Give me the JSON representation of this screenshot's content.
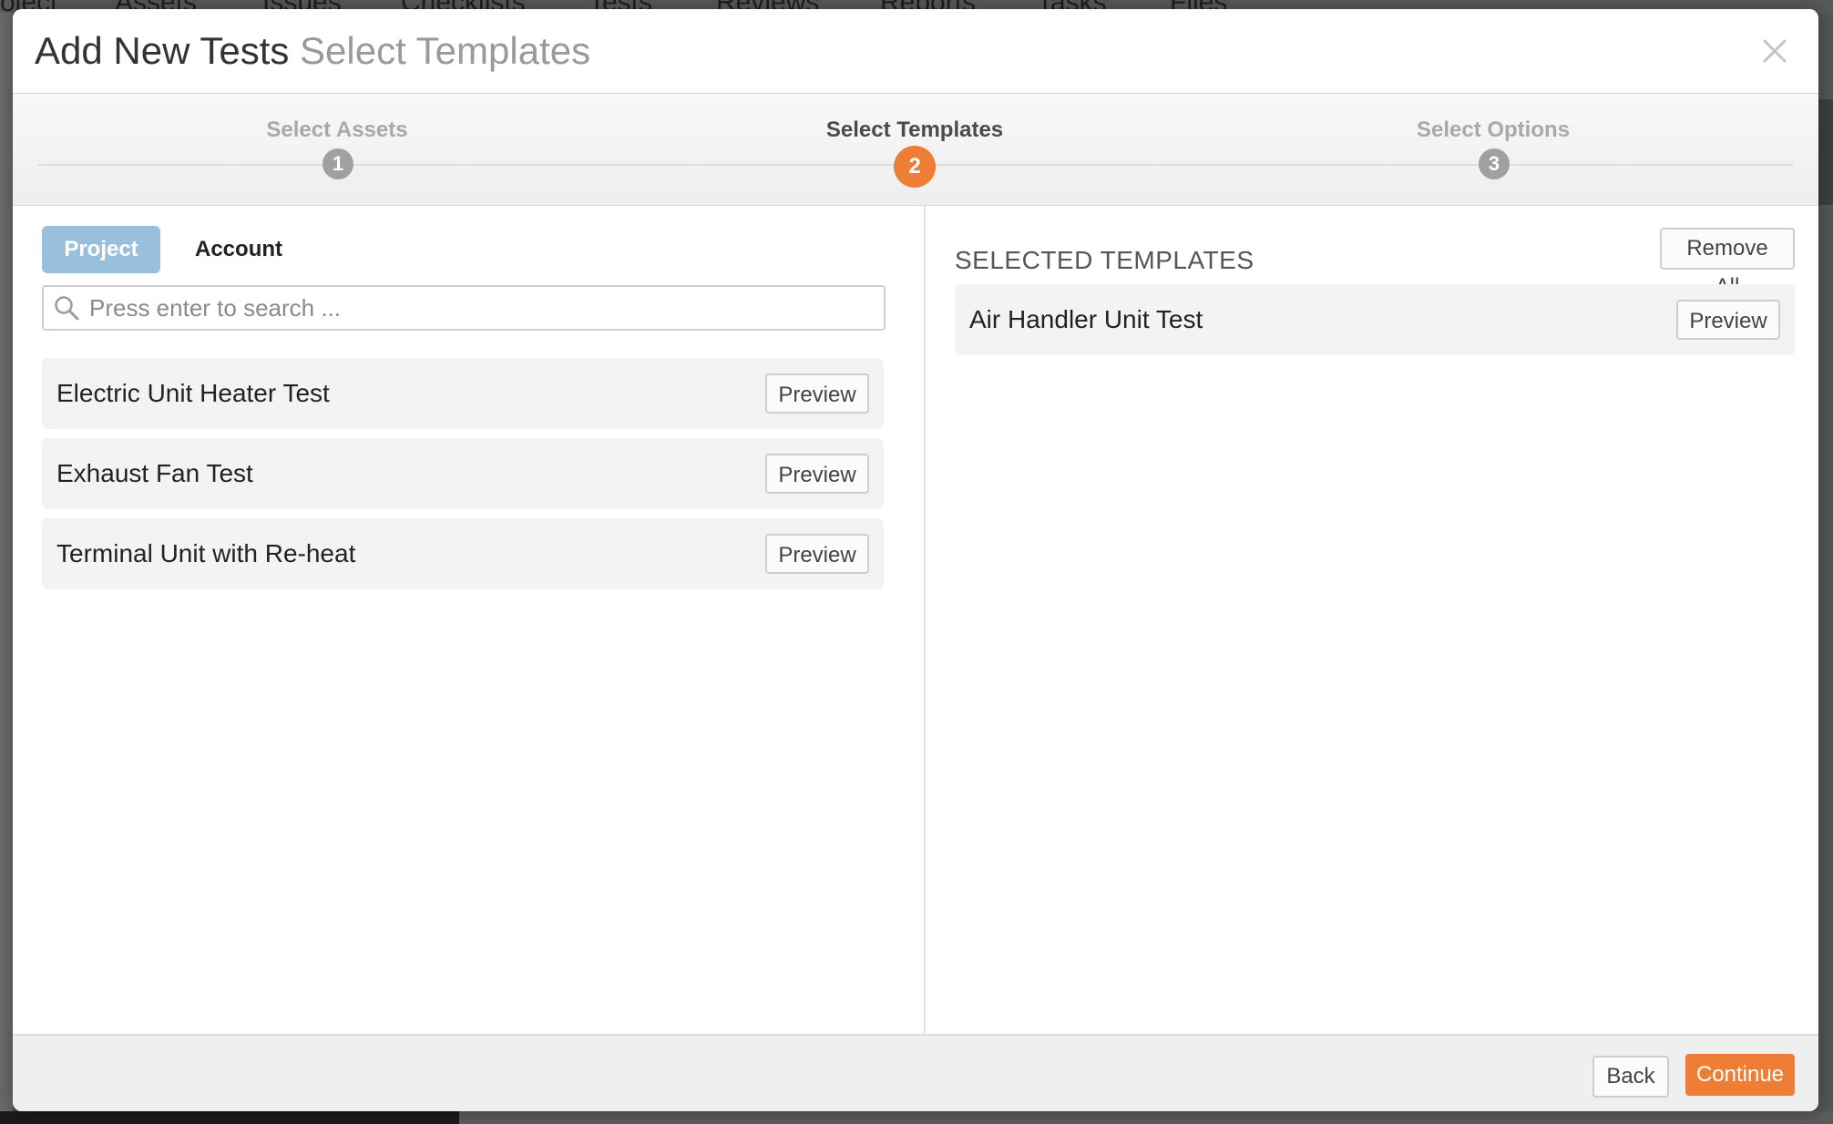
{
  "background_nav": {
    "items": [
      "oject",
      "Assets",
      "Issues",
      "Checklists",
      "Tests",
      "Reviews",
      "Reports",
      "Tasks",
      "Files"
    ]
  },
  "modal": {
    "title": "Add New Tests",
    "subtitle": "Select Templates"
  },
  "steps": [
    {
      "label": "Select Assets",
      "number": "1",
      "state": "done"
    },
    {
      "label": "Select Templates",
      "number": "2",
      "state": "active"
    },
    {
      "label": "Select Options",
      "number": "3",
      "state": "pending"
    }
  ],
  "tabs": {
    "project": "Project",
    "account": "Account",
    "active": "Project"
  },
  "search": {
    "placeholder": "Press enter to search ...",
    "value": ""
  },
  "templates": [
    {
      "name": "Electric Unit Heater Test",
      "action": "Preview"
    },
    {
      "name": "Exhaust Fan Test",
      "action": "Preview"
    },
    {
      "name": "Terminal Unit with Re-heat",
      "action": "Preview"
    }
  ],
  "selected": {
    "header": "SELECTED TEMPLATES",
    "remove_all": "Remove All",
    "items": [
      {
        "name": "Air Handler Unit Test",
        "action": "Preview"
      }
    ]
  },
  "footer": {
    "back": "Back",
    "continue": "Continue"
  },
  "colors": {
    "accent": "#ee7d35",
    "tab_active": "#98c0dc"
  }
}
